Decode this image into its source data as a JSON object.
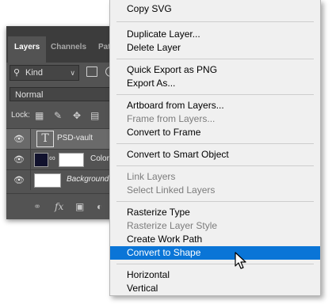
{
  "layers_panel": {
    "tabs": [
      {
        "label": "Layers",
        "active": true
      },
      {
        "label": "Channels",
        "active": false
      },
      {
        "label": "Pat",
        "active": false
      }
    ],
    "filter_kind": "Kind",
    "blend_mode": "Normal",
    "lock_label": "Lock:",
    "layers": [
      {
        "name": "PSD-vault",
        "type": "text",
        "visible": true,
        "selected": true
      },
      {
        "name": "Color",
        "type": "fill",
        "visible": true,
        "selected": false
      },
      {
        "name": "Background",
        "type": "image",
        "visible": true,
        "selected": false
      }
    ],
    "bottom_icons": [
      "link-icon",
      "fx-icon",
      "mask-icon",
      "adjustment-icon"
    ]
  },
  "context_menu": {
    "items": [
      {
        "label": "Copy SVG",
        "disabled": false
      },
      {
        "label": "Duplicate Layer...",
        "disabled": false
      },
      {
        "label": "Delete Layer",
        "disabled": false
      },
      {
        "label": "Quick Export as PNG",
        "disabled": false
      },
      {
        "label": "Export As...",
        "disabled": false
      },
      {
        "label": "Artboard from Layers...",
        "disabled": false
      },
      {
        "label": "Frame from Layers...",
        "disabled": true
      },
      {
        "label": "Convert to Frame",
        "disabled": false
      },
      {
        "label": "Convert to Smart Object",
        "disabled": false
      },
      {
        "label": "Link Layers",
        "disabled": true
      },
      {
        "label": "Select Linked Layers",
        "disabled": true
      },
      {
        "label": "Rasterize Type",
        "disabled": false
      },
      {
        "label": "Rasterize Layer Style",
        "disabled": true
      },
      {
        "label": "Create Work Path",
        "disabled": false
      },
      {
        "label": "Convert to Shape",
        "disabled": false,
        "highlighted": true
      },
      {
        "label": "Horizontal",
        "disabled": false
      },
      {
        "label": "Vertical",
        "disabled": false
      }
    ]
  },
  "colors": {
    "panel_bg": "#535353",
    "highlight": "#0a75d7",
    "menu_bg": "#f0f0f0",
    "disabled_text": "#7c7c7c"
  }
}
